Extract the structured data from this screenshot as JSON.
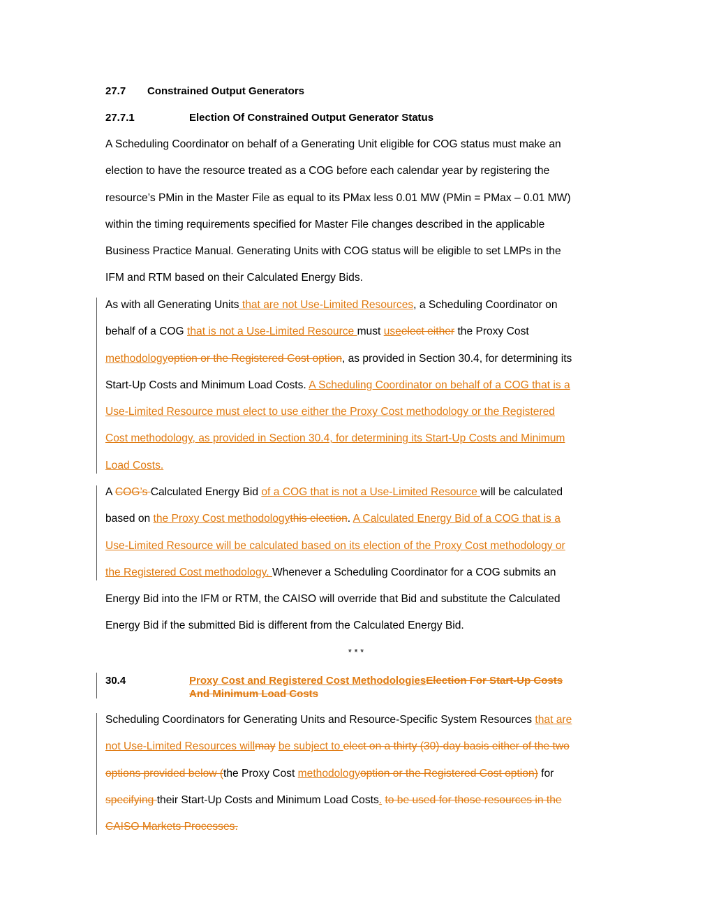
{
  "colors": {
    "text": "#000000",
    "tracked_change": "#E07A10",
    "change_bar": "#555555"
  },
  "section_27_7": {
    "number": "27.7",
    "title": "Constrained Output Generators"
  },
  "section_27_7_1": {
    "number": "27.7.1",
    "title": "Election Of Constrained Output Generator Status"
  },
  "para1": {
    "lines": [
      "A Scheduling Coordinator on behalf of a Generating Unit eligible for COG status must make an",
      "election to have the resource treated as a COG before each calendar year by registering the",
      "resource’s PMin in the Master File as equal to its PMax less 0.01 MW (PMin = PMax – 0.01 MW)",
      "within the timing requirements specified for Master File changes described in the applicable",
      "Business Practice Manual.  Generating Units with COG status will be eligible to set LMPs in the",
      "IFM and RTM based on their Calculated Energy Bids."
    ]
  },
  "para2": {
    "l1": {
      "a": "As with all Generating Units",
      "ins1": " that are not Use-Limited Resources",
      "b": ", a Scheduling Coordinator on"
    },
    "l2": {
      "a": "behalf of a COG ",
      "ins1": "that is not a Use-Limited Resource ",
      "b": "must ",
      "ins2": "use",
      "del1": "elect either",
      "c": " the Proxy Cost"
    },
    "l3": {
      "ins1": "methodology",
      "del1": "option or the Registered Cost option",
      "a": ", as provided in Section 30.4, for determining its"
    },
    "l4": {
      "a": "Start-Up Costs and Minimum Load Costs.  ",
      "ins1": "A Scheduling Coordinator on behalf of a COG that is a"
    },
    "l5": {
      "ins1": "Use-Limited Resource must elect to use either the Proxy Cost methodology or the Registered "
    },
    "l6": {
      "ins1": "Cost methodology, as provided in Section 30.4, for determining its Start-Up Costs and Minimum "
    },
    "l7": {
      "ins1": "Load Costs."
    }
  },
  "para3": {
    "l1": {
      "a": "A ",
      "del1": "COG’s ",
      "b": "Calculated Energy Bid ",
      "ins1": "of a COG that is not a Use-Limited Resource ",
      "c": "will be calculated"
    },
    "l2": {
      "a": "based on ",
      "ins1": "the Proxy Cost methodology",
      "del1": "this election",
      "b": ".  ",
      "ins2": "A Calculated Energy Bid of a COG that is a "
    },
    "l3": {
      "ins1": "Use-Limited Resource will be calculated based on its election of the Proxy Cost methodology or "
    },
    "l4": {
      "ins1": "the Registered Cost methodology.  ",
      "a": "Whenever a Scheduling Coordinator for a COG submits an"
    },
    "l5": {
      "a": "Energy Bid into the IFM or RTM, the CAISO will override that Bid and substitute the Calculated"
    },
    "l6": {
      "a": "Energy Bid if the submitted Bid is different from the Calculated Energy Bid."
    }
  },
  "separator": "* * *",
  "section_30_4": {
    "number": "30.4",
    "title_inserted": "Proxy Cost and Registered Cost Methodologies",
    "title_deleted_1": "Election For Start-Up Costs ",
    "title_deleted_2": "And Minimum Load Costs"
  },
  "para4": {
    "l1": {
      "a": "Scheduling Coordinators for Generating Units and Resource-Specific System Resources ",
      "ins1": "that are "
    },
    "l2": {
      "ins1": "not Use-Limited Resources will",
      "del1": "may",
      "a": " ",
      "ins2": "be subject to ",
      "del2": "elect on a thirty (30)-day basis either of the two "
    },
    "l3": {
      "del1": "options provided below (",
      "a": "the Proxy Cost ",
      "ins1": "methodology",
      "del2": "option or the Registered Cost option)",
      "b": " for"
    },
    "l4": {
      "del1": "specifying ",
      "a": "their Start-Up Costs and Minimum Load Costs",
      "ins1": ".",
      "b": " ",
      "del2": "to be used for those resources in the "
    },
    "l5": {
      "del1": "CAISO Markets Processes."
    }
  }
}
